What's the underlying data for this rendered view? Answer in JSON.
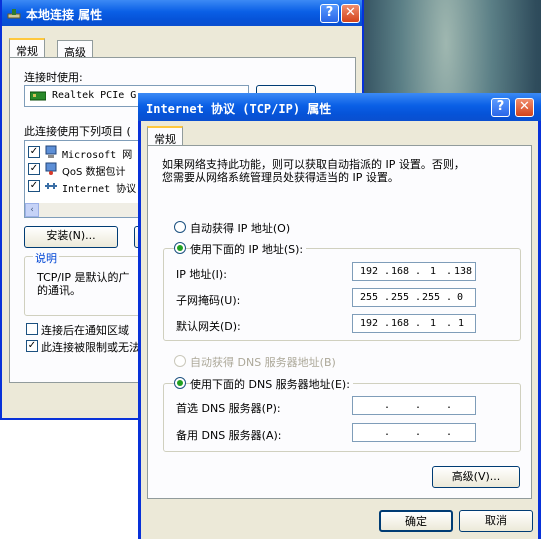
{
  "back_window": {
    "title": "本地连接 属性",
    "tabs": [
      "常规",
      "高级"
    ],
    "connect_using_label": "连接时使用:",
    "adapter": "Realtek PCIe G",
    "items_label": "此连接使用下列项目 (",
    "items": [
      {
        "label": "Microsoft 网",
        "checked": true
      },
      {
        "label": "QoS 数据包计",
        "checked": true
      },
      {
        "label": "Internet 协议",
        "checked": true
      }
    ],
    "install_button": "安装(N)...",
    "description_title": "说明",
    "description_text": "TCP/IP 是默认的广",
    "description_text2": "的通讯。",
    "checkbox_notify": "连接后在通知区域",
    "checkbox_limited": "此连接被限制或无法"
  },
  "front_window": {
    "title": "Internet 协议 (TCP/IP) 属性",
    "tab": "常规",
    "intro_line1": "如果网络支持此功能，则可以获取自动指派的 IP 设置。否则，",
    "intro_line2": "您需要从网络系统管理员处获得适当的 IP 设置。",
    "radio_auto_ip": "自动获得 IP 地址(O)",
    "radio_manual_ip": "使用下面的 IP 地址(S):",
    "ip_label": "IP 地址(I):",
    "ip": [
      "192",
      "168",
      "1",
      "138"
    ],
    "mask_label": "子网掩码(U):",
    "mask": [
      "255",
      "255",
      "255",
      "0"
    ],
    "gateway_label": "默认网关(D):",
    "gateway": [
      "192",
      "168",
      "1",
      "1"
    ],
    "radio_auto_dns": "自动获得 DNS 服务器地址(B)",
    "radio_manual_dns": "使用下面的 DNS 服务器地址(E):",
    "dns1_label": "首选 DNS 服务器(P):",
    "dns2_label": "备用 DNS 服务器(A):",
    "advanced_button": "高级(V)...",
    "ok_button": "确定",
    "cancel_button": "取消"
  }
}
